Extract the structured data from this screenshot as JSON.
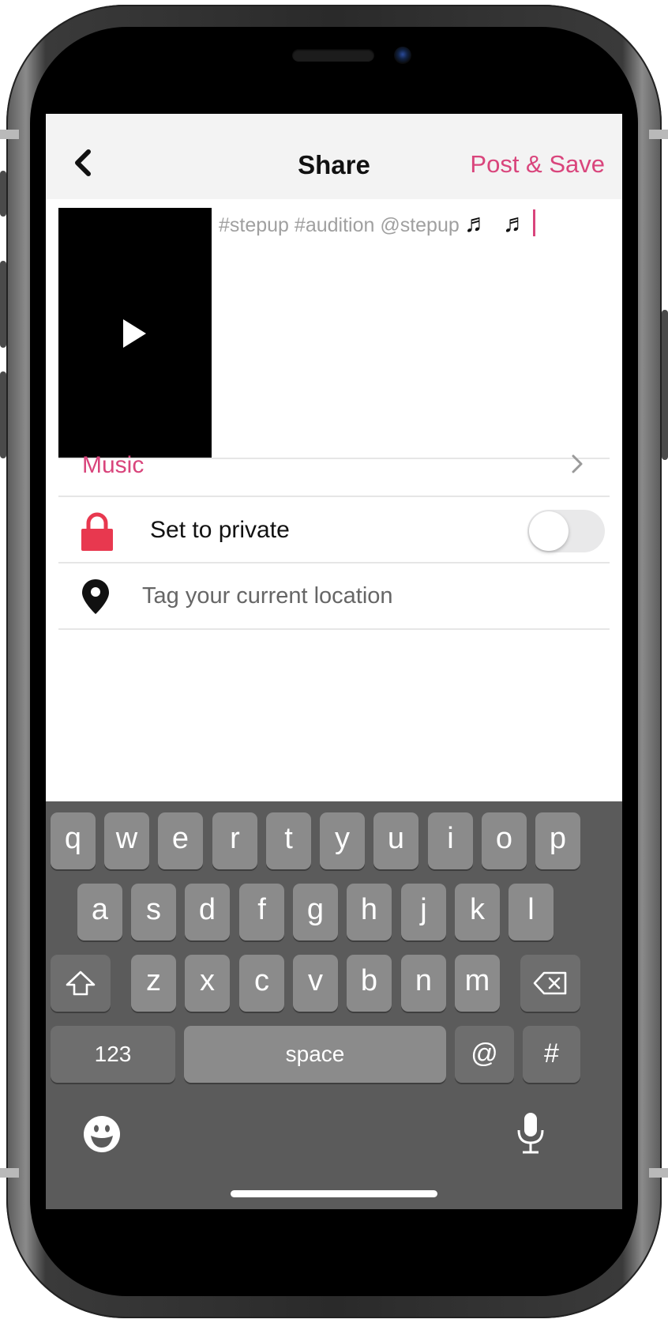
{
  "nav": {
    "title": "Share",
    "action_label": "Post & Save",
    "back_icon": "chevron-left-icon"
  },
  "caption": {
    "text": "#stepup #audition @stepup",
    "music_notes": "♬ ♬"
  },
  "video_thumbnail": {
    "icon": "play-icon"
  },
  "options": {
    "music_label": "Music",
    "private_label": "Set to private",
    "private_enabled": false,
    "location_placeholder": "Tag your current location"
  },
  "keyboard": {
    "row1": [
      "q",
      "w",
      "e",
      "r",
      "t",
      "y",
      "u",
      "i",
      "o",
      "p"
    ],
    "row2": [
      "a",
      "s",
      "d",
      "f",
      "g",
      "h",
      "j",
      "k",
      "l"
    ],
    "row3": [
      "z",
      "x",
      "c",
      "v",
      "b",
      "n",
      "m"
    ],
    "numbers_label": "123",
    "space_label": "space",
    "at_label": "@",
    "hash_label": "#"
  },
  "colors": {
    "accent": "#d9457c",
    "lock": "#e8384f",
    "keyboard_bg": "#5b5b5b",
    "key": "#8b8b8b"
  }
}
